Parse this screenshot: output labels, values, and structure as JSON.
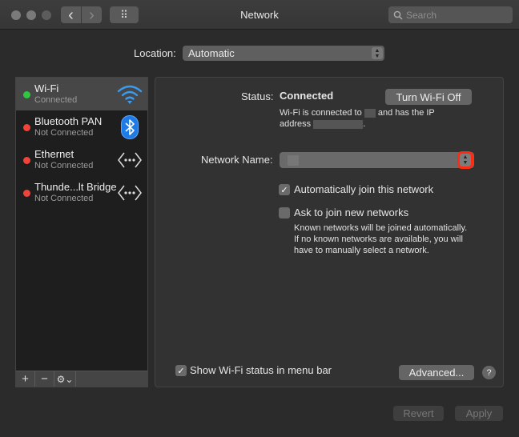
{
  "window": {
    "title": "Network",
    "search_placeholder": "Search",
    "back_glyph": "‹",
    "forward_glyph": "›",
    "grid_glyph": "⠿"
  },
  "location": {
    "label": "Location:",
    "value": "Automatic"
  },
  "services": [
    {
      "name": "Wi-Fi",
      "status": "Connected",
      "status_color": "#2ec840",
      "icon": "wifi-icon",
      "selected": true
    },
    {
      "name": "Bluetooth PAN",
      "status": "Not Connected",
      "status_color": "#f2433b",
      "icon": "bluetooth-icon",
      "selected": false
    },
    {
      "name": "Ethernet",
      "status": "Not Connected",
      "status_color": "#f2433b",
      "icon": "ethernet-icon",
      "selected": false
    },
    {
      "name": "Thunde...lt Bridge",
      "status": "Not Connected",
      "status_color": "#f2433b",
      "icon": "thunderbolt-bridge-icon",
      "selected": false
    }
  ],
  "sidebar_controls": {
    "add": "+",
    "remove": "−",
    "gear": "⚙⌄"
  },
  "detail": {
    "status_label": "Status:",
    "status_value": "Connected",
    "turn_off_button": "Turn Wi-Fi Off",
    "status_desc_1": "Wi-Fi is connected to",
    "status_desc_2": "and has the IP",
    "status_desc_3": "address",
    "status_desc_4": ".",
    "network_name_label": "Network Name:",
    "network_name_value": "",
    "auto_join_label": "Automatically join this network",
    "auto_join_checked": true,
    "ask_join_label": "Ask to join new networks",
    "ask_join_checked": false,
    "ask_join_help": "Known networks will be joined automatically. If no known networks are available, you will have to manually select a network.",
    "show_status_label": "Show Wi-Fi status in menu bar",
    "show_status_checked": true,
    "advanced_button": "Advanced...",
    "help_glyph": "?"
  },
  "footer": {
    "revert_button": "Revert",
    "apply_button": "Apply"
  },
  "highlight_color": "#ff2a12"
}
